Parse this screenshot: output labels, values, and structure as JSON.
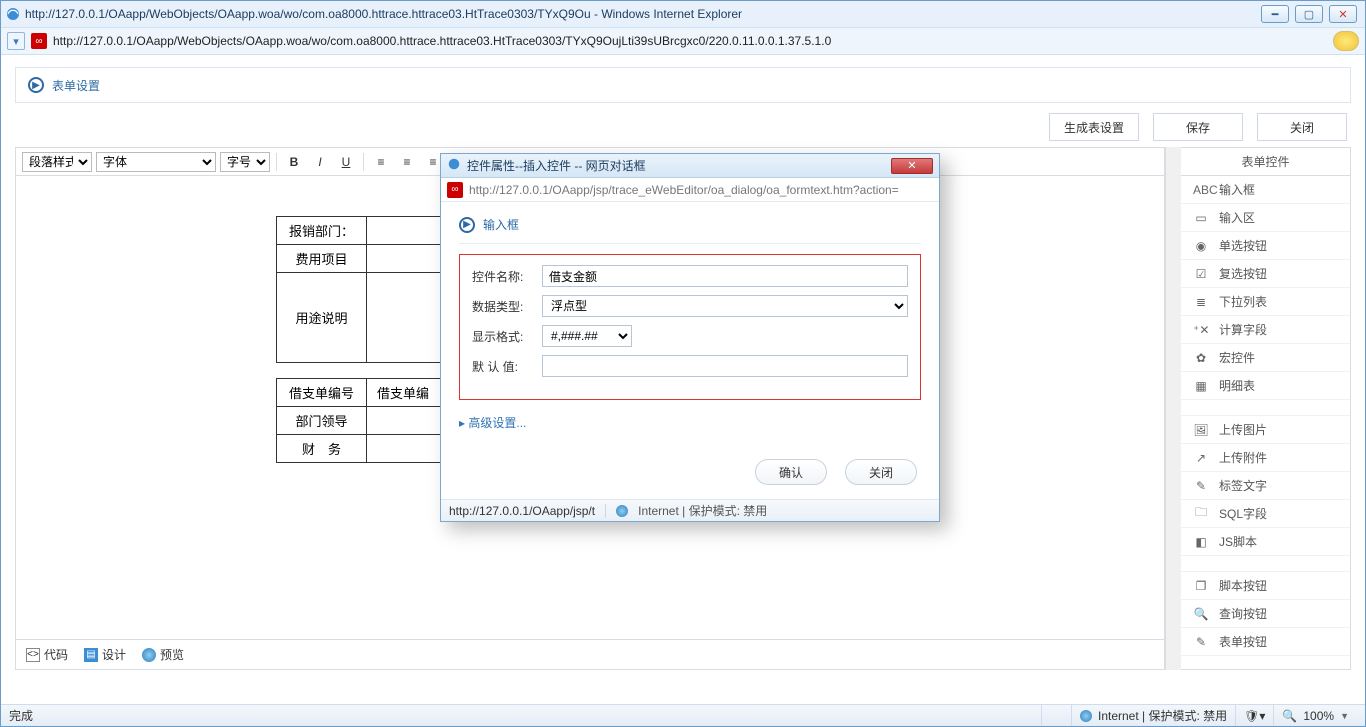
{
  "browser": {
    "title": "http://127.0.0.1/OAapp/WebObjects/OAapp.woa/wo/com.oa8000.httrace.httrace03.HtTrace0303/TYxQ9Ou - Windows Internet Explorer",
    "url_display": "http://127.0.0.1/OAapp/WebObjects/OAapp.woa/wo/com.oa8000.httrace.httrace03.HtTrace0303/TYxQ9OujLti39sUBrcgxc0/220.0.11.0.0.1.37.5.1.0",
    "status_left": "完成",
    "status_internet": "Internet | 保护模式: 禁用",
    "zoom": "100%"
  },
  "page": {
    "header": "表单设置",
    "buttons": {
      "generate": "生成表设置",
      "save": "保存",
      "close": "关闭"
    }
  },
  "toolbar": {
    "para": "段落样式",
    "font": "字体",
    "size": "字号"
  },
  "form_table": {
    "r1c1": "报销部门：",
    "r2c1": "费用项目",
    "r3c1": "用途说明",
    "r4c1": "借支单编号",
    "r4c2": "借支单编",
    "r5c1": "部门领导",
    "r6c1": "财　务"
  },
  "editor_tabs": {
    "code": "代码",
    "design": "设计",
    "preview": "预览"
  },
  "side": {
    "title": "表单控件",
    "items": [
      {
        "icon": "ABC",
        "label": "输入框"
      },
      {
        "icon": "▭",
        "label": "输入区"
      },
      {
        "icon": "◉",
        "label": "单选按钮"
      },
      {
        "icon": "☑",
        "label": "复选按钮"
      },
      {
        "icon": "≣",
        "label": "下拉列表"
      },
      {
        "icon": "⁺✕",
        "label": "计算字段"
      },
      {
        "icon": "✿",
        "label": "宏控件"
      },
      {
        "icon": "▦",
        "label": "明细表"
      }
    ],
    "items2": [
      {
        "icon": "🖼",
        "label": "上传图片"
      },
      {
        "icon": "↗",
        "label": "上传附件"
      },
      {
        "icon": "✎",
        "label": "标签文字"
      },
      {
        "icon": "🗀",
        "label": "SQL字段"
      },
      {
        "icon": "◧",
        "label": "JS脚本"
      }
    ],
    "items3": [
      {
        "icon": "❐",
        "label": "脚本按钮"
      },
      {
        "icon": "🔍",
        "label": "查询按钮"
      },
      {
        "icon": "✎",
        "label": "表单按钮"
      }
    ]
  },
  "dialog": {
    "title": "控件属性--插入控件 -- 网页对话框",
    "url": "http://127.0.0.1/OAapp/jsp/trace_eWebEditor/oa_dialog/oa_formtext.htm?action=",
    "section": "输入框",
    "fields": {
      "name_label": "控件名称:",
      "name_value": "借支金额",
      "type_label": "数据类型:",
      "type_value": "浮点型",
      "format_label": "显示格式:",
      "format_value": "#,###.##",
      "default_label": "默 认 值:",
      "default_value": ""
    },
    "advanced": "高级设置...",
    "ok": "确认",
    "cancel": "关闭",
    "status_path": "http://127.0.0.1/OAapp/jsp/t",
    "status_mode": "Internet | 保护模式: 禁用"
  }
}
